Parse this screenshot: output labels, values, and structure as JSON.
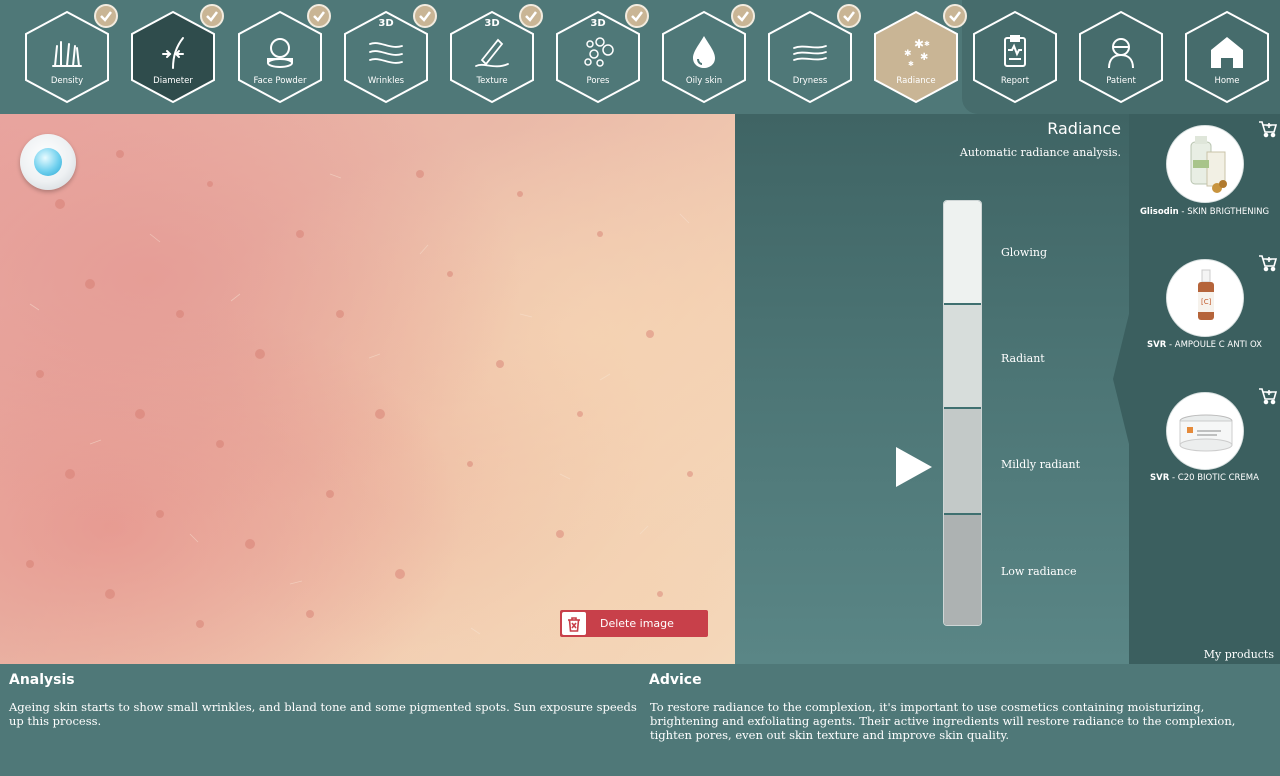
{
  "nav": {
    "items": [
      {
        "label": "Density",
        "badge": "",
        "checked": true,
        "icon": "density-icon"
      },
      {
        "label": "Diameter",
        "badge": "",
        "checked": true,
        "icon": "diameter-icon"
      },
      {
        "label": "Face Powder",
        "badge": "",
        "checked": true,
        "icon": "face-powder-icon"
      },
      {
        "label": "Wrinkles",
        "badge": "3D",
        "checked": true,
        "icon": "wrinkles-icon"
      },
      {
        "label": "Texture",
        "badge": "3D",
        "checked": true,
        "icon": "texture-icon"
      },
      {
        "label": "Pores",
        "badge": "3D",
        "checked": true,
        "icon": "pores-icon"
      },
      {
        "label": "Oily skin",
        "badge": "",
        "checked": true,
        "icon": "oily-skin-icon"
      },
      {
        "label": "Dryness",
        "badge": "",
        "checked": true,
        "icon": "dryness-icon"
      },
      {
        "label": "Radiance",
        "badge": "",
        "checked": true,
        "icon": "radiance-icon"
      }
    ],
    "right_items": [
      {
        "label": "Report",
        "icon": "report-icon"
      },
      {
        "label": "Patient",
        "icon": "patient-icon"
      },
      {
        "label": "Home",
        "icon": "home-icon"
      }
    ]
  },
  "image": {
    "delete_label": "Delete image"
  },
  "radiance": {
    "title": "Radiance",
    "subtitle": "Automatic radiance analysis.",
    "levels": [
      "Glowing",
      "Radiant",
      "Mildly radiant",
      "Low radiance"
    ]
  },
  "products": {
    "items": [
      {
        "brand": "Glisodin",
        "sep": " - ",
        "name": "SKIN BRIGTHENING"
      },
      {
        "brand": "SVR",
        "sep": " - ",
        "name": "AMPOULE C ANTI OX"
      },
      {
        "brand": "SVR",
        "sep": " - ",
        "name": "C20 BIOTIC CREMA"
      }
    ],
    "footer": "My products"
  },
  "analysis": {
    "title": "Analysis",
    "text": "Ageing skin starts to show small wrinkles, and bland tone and some pigmented spots. Sun exposure speeds up this process."
  },
  "advice": {
    "title": "Advice",
    "text": "To restore radiance to the complexion, it's important to use cosmetics containing moisturizing, brightening and exfoliating agents. Their active ingredients will restore radiance to the complexion, tighten pores, even out skin texture and improve skin quality."
  },
  "colors": {
    "accent": "#c9b595",
    "background": "#4f7878",
    "delete": "#c8404a"
  }
}
